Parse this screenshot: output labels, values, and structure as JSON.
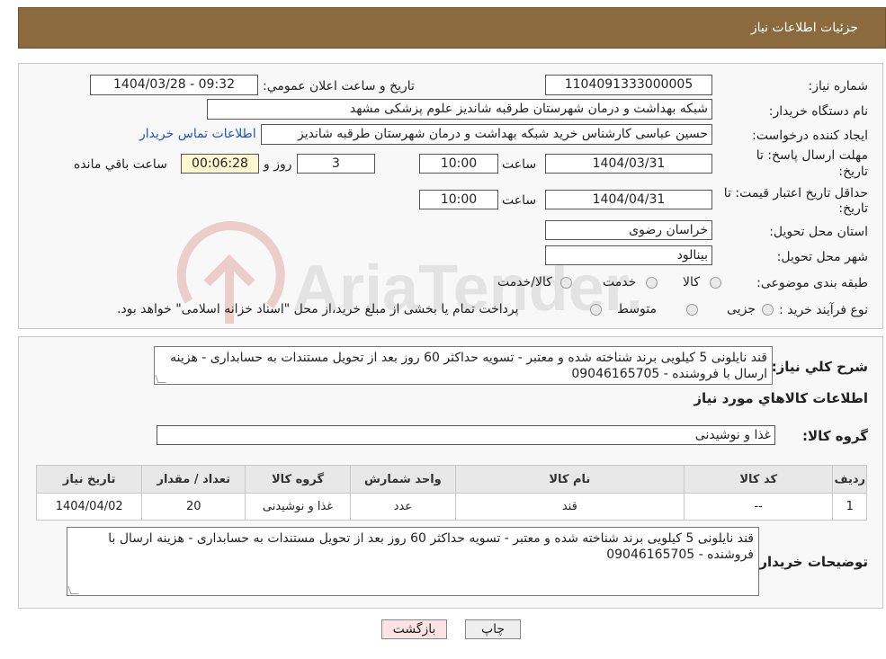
{
  "header": {
    "title": "جزئیات اطلاعات نیاز"
  },
  "watermark": {
    "text": "AriaTender.neT"
  },
  "form": {
    "need_number_label": "شماره نیاز:",
    "need_number": "1104091333000005",
    "announce_label": "تاریخ و ساعت اعلان عمومي:",
    "announce_value": "1404/03/28 - 09:32",
    "buyer_org_label": "نام دستگاه خریدار:",
    "buyer_org": "شبکه بهداشت و درمان شهرستان طرقبه شاندیز   علوم پزشکی مشهد",
    "creator_label": "ایجاد کننده درخواست:",
    "creator": "حسین عباسی کارشناس خرید شبکه بهداشت و درمان شهرستان طرقبه شاندیز",
    "contact_link": "اطلاعات تماس خریدار",
    "deadline_label_1": "مهلت ارسال پاسخ: تا",
    "deadline_label_2": "تاریخ:",
    "deadline_date": "1404/03/31",
    "time_label": "ساعت",
    "deadline_time": "10:00",
    "days_value": "3",
    "days_label": "روز و",
    "remaining_value": "00:06:28",
    "remaining_label": "ساعت باقي مانده",
    "validity_label_1": "حداقل تاریخ اعتبار قیمت: تا",
    "validity_label_2": "تاریخ:",
    "validity_date": "1404/04/31",
    "validity_time": "10:00",
    "province_label": "استان محل تحویل:",
    "province": "خراسان رضوی",
    "city_label": "شهر محل تحویل:",
    "city": "بینالود",
    "category_label": "طبقه بندی موضوعی:",
    "category_options": [
      "کالا",
      "خدمت",
      "کالا/خدمت"
    ],
    "purchase_type_label": "نوع فرآیند خرید :",
    "purchase_options": [
      "جزیی",
      "متوسط"
    ],
    "purchase_note": "پرداخت تمام یا بخشی از مبلغ خرید،از محل \"اسناد خزانه اسلامی\" خواهد بود."
  },
  "details": {
    "description_label": "شرح کلي نیاز:",
    "description": "قند نایلونی 5 کیلویی برند شناخته شده و معتبر - تسویه حداکثر 60 روز بعد از تحویل مستندات به حسابداری - هزینه ارسال با فروشنده - 09046165705",
    "goods_info_title": "اطلاعات کالاهاي مورد نیاز",
    "goods_group_label": "گروه کالا:",
    "goods_group": "غذا و نوشیدنی",
    "table": {
      "headers": [
        "ردیف",
        "کد کالا",
        "نام کالا",
        "واحد شمارش",
        "گروه کالا",
        "تعداد / مقدار",
        "تاریخ نیاز"
      ],
      "rows": [
        [
          "1",
          "--",
          "قند",
          "عدد",
          "غذا و نوشیدنی",
          "20",
          "1404/04/02"
        ]
      ]
    },
    "buyer_notes_label": "توضیحات خریدار:",
    "buyer_notes": "قند نایلونی 5 کیلویی برند شناخته شده و معتبر - تسویه حداکثر 60 روز بعد از تحویل مستندات به حسابداری - هزینه ارسال با فروشنده - 09046165705"
  },
  "buttons": {
    "print": "چاپ",
    "back": "بازگشت"
  },
  "colors": {
    "header_bg": "#8b6b3d",
    "link": "#1a55c8",
    "remaining_bg": "#fff7cf",
    "back_bg": "#fde3e3"
  }
}
